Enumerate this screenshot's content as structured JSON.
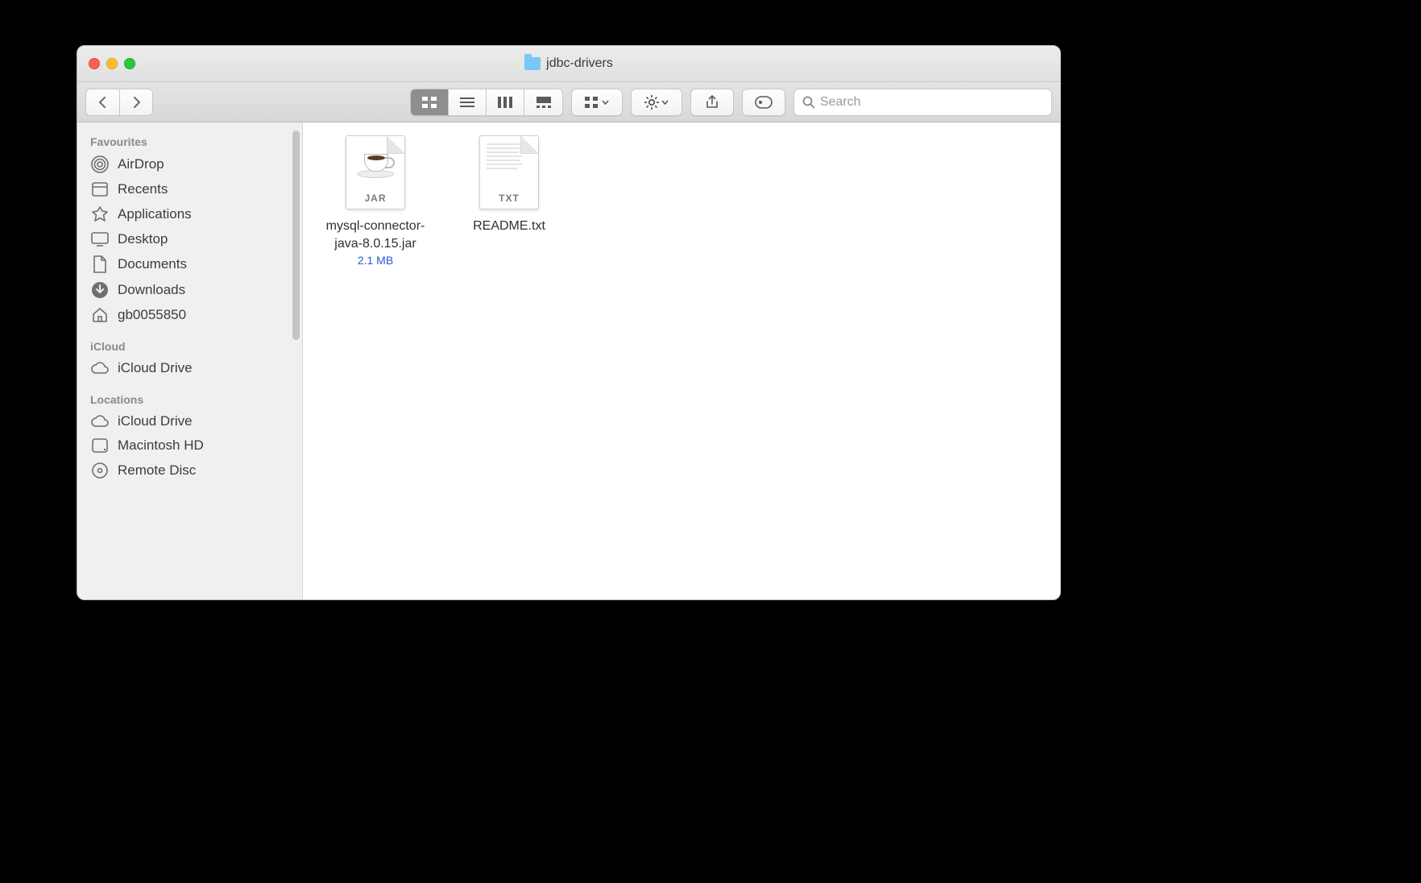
{
  "window": {
    "title": "jdbc-drivers"
  },
  "toolbar": {
    "search_placeholder": "Search"
  },
  "sidebar": {
    "sections": [
      {
        "label": "Favourites",
        "items": [
          {
            "label": "AirDrop"
          },
          {
            "label": "Recents"
          },
          {
            "label": "Applications"
          },
          {
            "label": "Desktop"
          },
          {
            "label": "Documents"
          },
          {
            "label": "Downloads"
          },
          {
            "label": "gb0055850"
          }
        ]
      },
      {
        "label": "iCloud",
        "items": [
          {
            "label": "iCloud Drive"
          }
        ]
      },
      {
        "label": "Locations",
        "items": [
          {
            "label": "iCloud Drive"
          },
          {
            "label": "Macintosh HD"
          },
          {
            "label": "Remote Disc"
          }
        ]
      }
    ]
  },
  "files": [
    {
      "name": "mysql-connector-java-8.0.15.jar",
      "ext": "JAR",
      "size": "2.1 MB"
    },
    {
      "name": "README.txt",
      "ext": "TXT",
      "size": ""
    }
  ]
}
